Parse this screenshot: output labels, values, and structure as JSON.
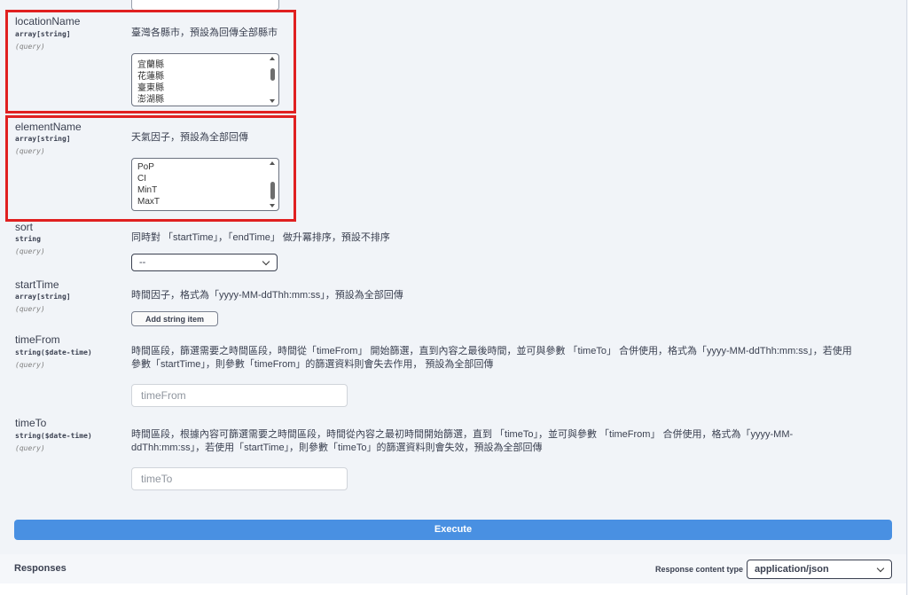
{
  "params": {
    "locationName": {
      "name": "locationName",
      "type": "array[string]",
      "in": "(query)",
      "description": "臺灣各縣市，預設為回傳全部縣市",
      "options": [
        "宜蘭縣",
        "花蓮縣",
        "臺東縣",
        "澎湖縣"
      ]
    },
    "elementName": {
      "name": "elementName",
      "type": "array[string]",
      "in": "(query)",
      "description": "天氣因子，預設為全部回傳",
      "options": [
        "PoP",
        "CI",
        "MinT",
        "MaxT"
      ]
    },
    "sort": {
      "name": "sort",
      "type": "string",
      "in": "(query)",
      "description": "同時對 「startTime」，「endTime」 做升冪排序，預設不排序",
      "selected": "--"
    },
    "startTime": {
      "name": "startTime",
      "type": "array[string]",
      "in": "(query)",
      "description": "時間因子，格式為「yyyy-MM-ddThh:mm:ss」，預設為全部回傳",
      "add_label": "Add string item"
    },
    "timeFrom": {
      "name": "timeFrom",
      "type": "string($date-time)",
      "in": "(query)",
      "description_line1": "時間區段，篩選需要之時間區段，時間從「timeFrom」 開始篩選，直到內容之最後時間，並可與參數 「timeTo」 合併使用，格式為「yyyy-MM-ddThh:mm:ss」，若使用",
      "description_line2": "參數「startTime」，則參數「timeFrom」的篩選資料則會失去作用， 預設為全部回傳",
      "placeholder": "timeFrom"
    },
    "timeTo": {
      "name": "timeTo",
      "type": "string($date-time)",
      "in": "(query)",
      "description_line1": "時間區段，根據內容可篩選需要之時間區段，時間從內容之最初時間開始篩選，直到 「timeTo」，並可與參數 「timeFrom」 合併使用，格式為「yyyy-MM-",
      "description_line2": "ddThh:mm:ss」，若使用「startTime」，則參數「timeTo」的篩選資料則會失效，預設為全部回傳",
      "placeholder": "timeTo"
    }
  },
  "execute_label": "Execute",
  "responses": {
    "title": "Responses",
    "content_type_label": "Response content type",
    "content_type_value": "application/json"
  },
  "colors": {
    "highlight": "#e02020",
    "execute": "#4990e2"
  }
}
